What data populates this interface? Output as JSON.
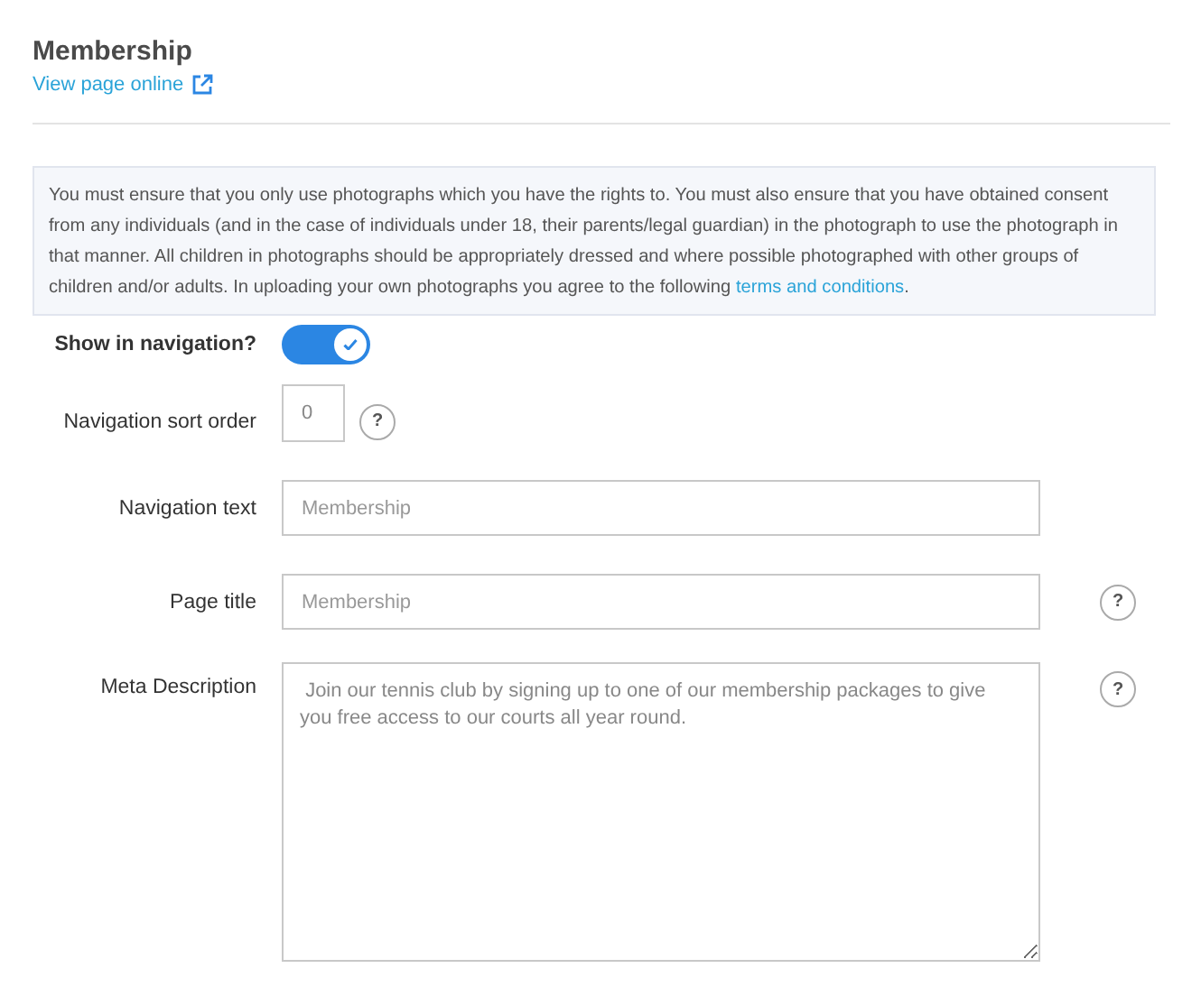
{
  "header": {
    "title": "Membership",
    "link": "View page online"
  },
  "notice": {
    "text": "You must ensure that you only use photographs which you have the rights to. You must also ensure that you have obtained consent from any individuals (and in the case of individuals under 18, their parents/legal guardian) in the photograph to use the photograph in that manner. All children in photographs should be appropriately dressed and where possible photographed with other groups of children and/or adults. In uploading your own photographs you agree to the following",
    "link": "terms and conditions",
    "after": "."
  },
  "fields": [
    {
      "kind": "toggle",
      "label": "Show in navigation?",
      "on": true
    },
    {
      "kind": "number",
      "label": "Navigation sort order",
      "value": "0",
      "help_text": "?"
    },
    {
      "kind": "text",
      "label": "Navigation text",
      "placeholder": "Membership"
    },
    {
      "kind": "text",
      "label": "Page title",
      "placeholder": "Membership",
      "help_text": "?"
    },
    {
      "kind": "textarea",
      "label": "Meta Description",
      "value": " Join our tennis club by signing up to one of our membership packages to give you free access to our courts all year round.",
      "help_text": "?"
    }
  ]
}
